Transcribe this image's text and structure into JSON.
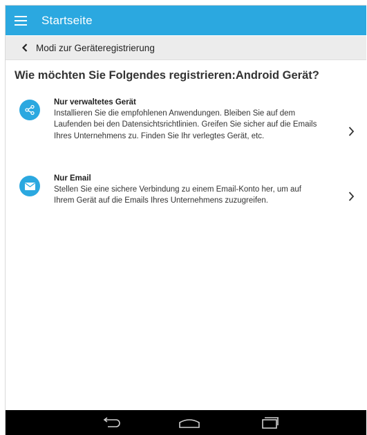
{
  "app_bar": {
    "title": "Startseite",
    "menu_icon": "hamburger-menu-icon",
    "background": "#2ba8e0"
  },
  "sub_bar": {
    "title": "Modi zur Geräteregistrierung",
    "back_icon": "chevron-left-icon"
  },
  "question": "Wie möchten Sie Folgendes registrieren:Android Gerät?",
  "options": [
    {
      "icon": "share-nodes-icon",
      "title": "Nur verwaltetes Gerät",
      "description": "Installieren Sie die empfohlenen Anwendungen. Bleiben Sie auf dem Laufenden bei den Datensichtsrichtlinien. Greifen Sie sicher auf die Emails Ihres Unternehmens zu. Finden Sie Ihr verlegtes Gerät, etc."
    },
    {
      "icon": "envelope-icon",
      "title": "Nur Email",
      "description": "Stellen Sie eine sichere Verbindung zu einem Email-Konto her, um auf Ihrem Gerät auf die Emails Ihres Unternehmens zuzugreifen."
    }
  ],
  "nav_bar": {
    "buttons": [
      "back-icon",
      "home-icon",
      "recent-apps-icon"
    ]
  },
  "colors": {
    "accent": "#2ba8e0",
    "sub_bar_bg": "#ececec",
    "nav_bar_bg": "#000000"
  }
}
